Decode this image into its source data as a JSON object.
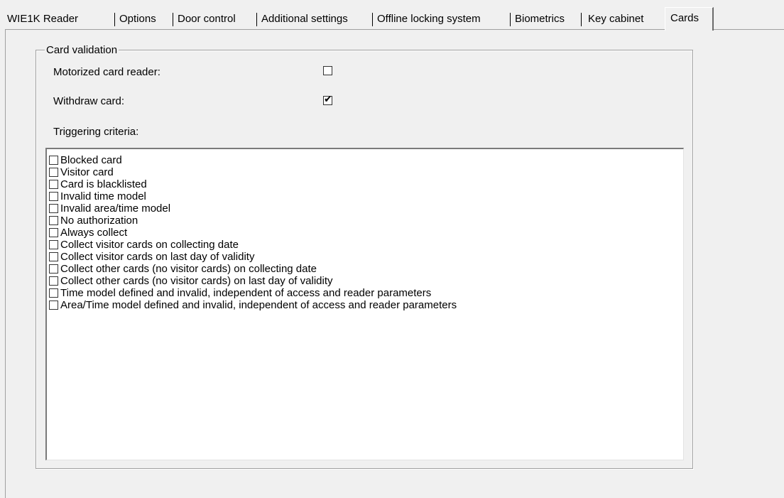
{
  "tabs": [
    {
      "label": "WIE1K Reader"
    },
    {
      "label": "Options"
    },
    {
      "label": "Door control"
    },
    {
      "label": "Additional settings"
    },
    {
      "label": "Offline locking system"
    },
    {
      "label": "Biometrics"
    },
    {
      "label": "Key cabinet"
    },
    {
      "label": "Cards"
    }
  ],
  "active_tab": "Cards",
  "group": {
    "title": "Card validation",
    "motorized_label": "Motorized card reader:",
    "motorized_checked": false,
    "withdraw_label": "Withdraw card:",
    "withdraw_checked": true,
    "criteria_label": "Triggering criteria:"
  },
  "criteria": [
    {
      "label": "Blocked card",
      "checked": false
    },
    {
      "label": "Visitor card",
      "checked": false
    },
    {
      "label": "Card is blacklisted",
      "checked": false
    },
    {
      "label": "Invalid time model",
      "checked": false
    },
    {
      "label": "Invalid area/time model",
      "checked": false
    },
    {
      "label": "No authorization",
      "checked": false
    },
    {
      "label": "Always collect",
      "checked": false
    },
    {
      "label": "Collect visitor cards on collecting date",
      "checked": false
    },
    {
      "label": "Collect visitor cards on last day of validity",
      "checked": false
    },
    {
      "label": "Collect other cards (no visitor cards) on collecting date",
      "checked": false
    },
    {
      "label": "Collect other cards (no visitor cards) on last day of validity",
      "checked": false
    },
    {
      "label": "Time model defined and invalid, independent of access and reader parameters",
      "checked": false
    },
    {
      "label": "Area/Time model defined and invalid, independent of access and reader parameters",
      "checked": false
    }
  ],
  "check_glyph": "✔"
}
